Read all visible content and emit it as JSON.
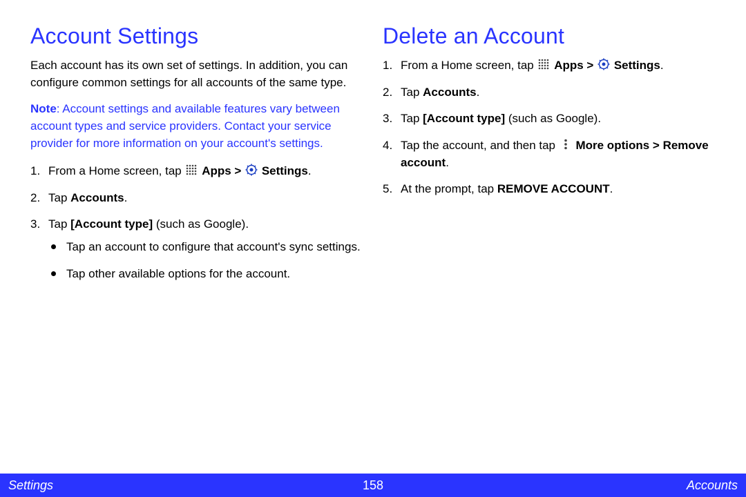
{
  "left": {
    "title": "Account Settings",
    "intro": "Each account has its own set of settings. In addition, you can configure common settings for all accounts of the same type.",
    "note_label": "Note",
    "note_text": ": Account settings and available features vary between account types and service providers. Contact your service provider for more information on your account's settings.",
    "step1": {
      "num": "1.",
      "pre": "From a Home screen, tap ",
      "apps": "Apps > ",
      "settings": "Settings",
      "post": "."
    },
    "step2": {
      "num": "2.",
      "pre": "Tap ",
      "b": "Accounts",
      "post": "."
    },
    "step3": {
      "num": "3.",
      "pre": "Tap ",
      "b": "[Account type]",
      "post": " (such as Google)."
    },
    "sub1": "Tap an account to configure that account's sync settings.",
    "sub2": "Tap other available options for the account."
  },
  "right": {
    "title": "Delete an Account",
    "step1": {
      "num": "1.",
      "pre": "From a Home screen, tap ",
      "apps": "Apps > ",
      "settings": "Settings",
      "post": "."
    },
    "step2": {
      "num": "2.",
      "pre": "Tap ",
      "b": "Accounts",
      "post": "."
    },
    "step3": {
      "num": "3.",
      "pre": "Tap ",
      "b": "[Account type]",
      "post": " (such as Google)."
    },
    "step4": {
      "num": "4.",
      "pre": "Tap the account, and then tap ",
      "b1": "More options > ",
      "b2": "Remove account",
      "post": "."
    },
    "step5": {
      "num": "5.",
      "pre": "At the prompt, tap ",
      "b": "REMOVE ACCOUNT",
      "post": "."
    }
  },
  "footer": {
    "left": "Settings",
    "center": "158",
    "right": "Accounts"
  }
}
